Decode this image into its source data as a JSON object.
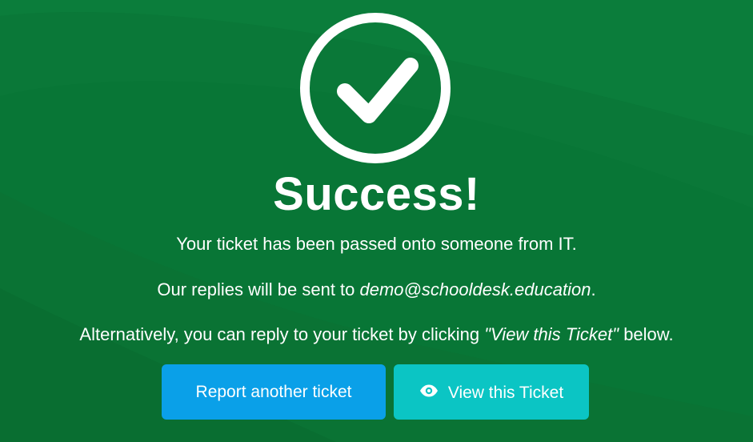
{
  "colors": {
    "background": "#0a7a3a",
    "primary_button": "#0aa0e8",
    "secondary_button": "#0bc5c4",
    "text": "#ffffff"
  },
  "status": {
    "icon": "check-circle-icon",
    "title": "Success!"
  },
  "message": {
    "line1": "Your ticket has been passed onto someone from IT.",
    "line2_prefix": "Our replies will be sent to ",
    "email": "demo@schooldesk.education",
    "line2_suffix": ".",
    "line3_prefix": "Alternatively, you can reply to your ticket by clicking ",
    "line3_quote": "\"View this Ticket\"",
    "line3_suffix": " below."
  },
  "actions": {
    "report_another_label": "Report another ticket",
    "view_ticket_label": "View this Ticket",
    "view_ticket_icon": "eye-icon"
  }
}
